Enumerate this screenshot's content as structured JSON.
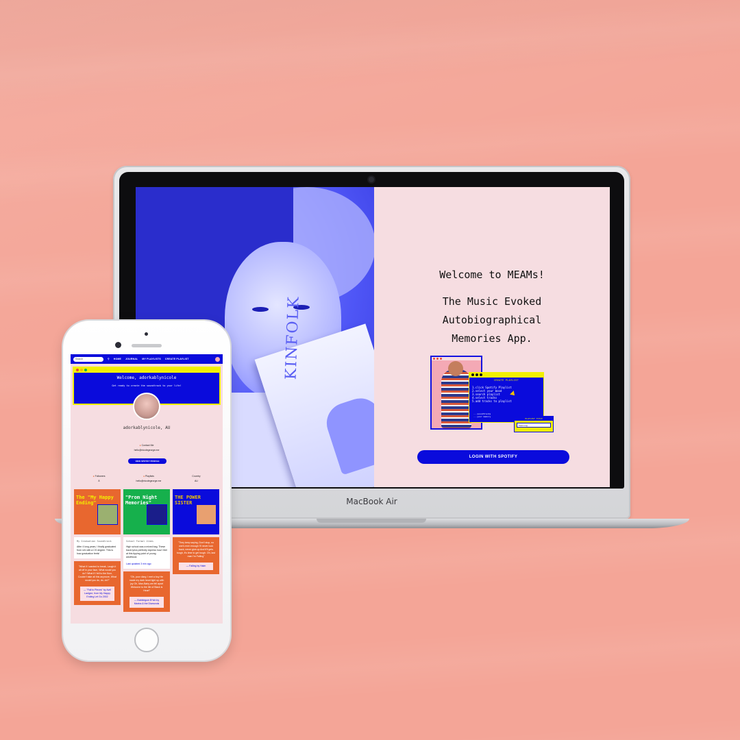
{
  "laptop": {
    "brand_name": "MacBook",
    "brand_model": "Air",
    "welcome": {
      "title": "Welcome to MEAMs!",
      "subtitle_lines": [
        "The Music Evoked",
        "Autobiographical",
        "Memories App."
      ],
      "login_button": "LOGIN WITH SPOTIFY"
    },
    "book_title": "KINFOLK",
    "collage": {
      "window_title": "CREATE PLAYLIST",
      "steps": [
        "1.click Spotify Playlist",
        "2.select your mood",
        "3.search playlist",
        "4.select tracks",
        "5.add tracks to playlist"
      ],
      "footer_lines": [
        "...soundtracks",
        "...your memory"
      ],
      "small_window_title": "PLAYLIST TITLE",
      "small_window_input": "Feeling"
    }
  },
  "phone": {
    "nav": {
      "search_placeholder": "Search",
      "items": [
        "HOME",
        "JOURNAL",
        "MY PLAYLISTS",
        "CREATE PLAYLIST"
      ]
    },
    "banner": {
      "heading": "Welcome, adorkablynicole",
      "subheading": "Get ready to create the soundtrack to your life!"
    },
    "profile": {
      "username": "adorkablynicole, AU",
      "contact_label": "Contact Me",
      "email": "hello@nicolegeorge.me",
      "spotify_button": "VIEW SPOTIFY PROFILE",
      "stats": [
        {
          "label": "Followers",
          "value": "8"
        },
        {
          "label": "Playlists",
          "value": "hello@nicolegeorge.me"
        },
        {
          "label": "Country",
          "value": "AU"
        }
      ]
    },
    "cards": [
      {
        "title": "The \"My Happy Ending\"",
        "caption": "My Graduation Soundtrack",
        "body": "After 4 long years, I finally graduated from Uni with a CS degree. This is how graduation feels!",
        "link": "",
        "bg": "#e8672f",
        "title_color": "#f2f000",
        "quote": "\"What if I wanted to break, Laugh it all off in your face, What would you do? What if I fell to the floor, Couldn't take all this anymore, What would you do, do, do?\"",
        "quote_button": "— \"Fall to Pieces\" by Avril Lavigne, from My Happy Ending Let Go 2002"
      },
      {
        "title": "\"Prom Night Memories\"",
        "caption": "School Formal Vibes",
        "body": "High school was a mixed bag. These track lyrics perfectly express how I feel at this tipping point of young adulthood.",
        "link": "Last updated 3 min ago",
        "bg": "#16b04c",
        "title_color": "#ffffff",
        "quote": "\"Oh, poor diary, I met a boy He made my dark heart light up with joy Oh, Man-Baby we fell apart Welcome to the life of Black is Heart\"",
        "quote_button": "— Bubblegum B*tch by Marina & the Diamonds"
      },
      {
        "title": "THE POWER SISTER",
        "caption": "",
        "body": "",
        "link": "",
        "bg": "#0a0bdc",
        "title_color": "#f2c200",
        "quote": "\"They keep saying, Don't stop, no one's ever enough I'll never look back, never give up And it'll gets tough, it's time to get tough. Oh, last man I'm Falling\"",
        "quote_button": "— Falling by Haim"
      }
    ]
  },
  "colors": {
    "background": "#f4a597",
    "blue": "#0a0bdc",
    "pink": "#f6dde1",
    "yellow": "#f2f000",
    "orange": "#e8672f"
  }
}
